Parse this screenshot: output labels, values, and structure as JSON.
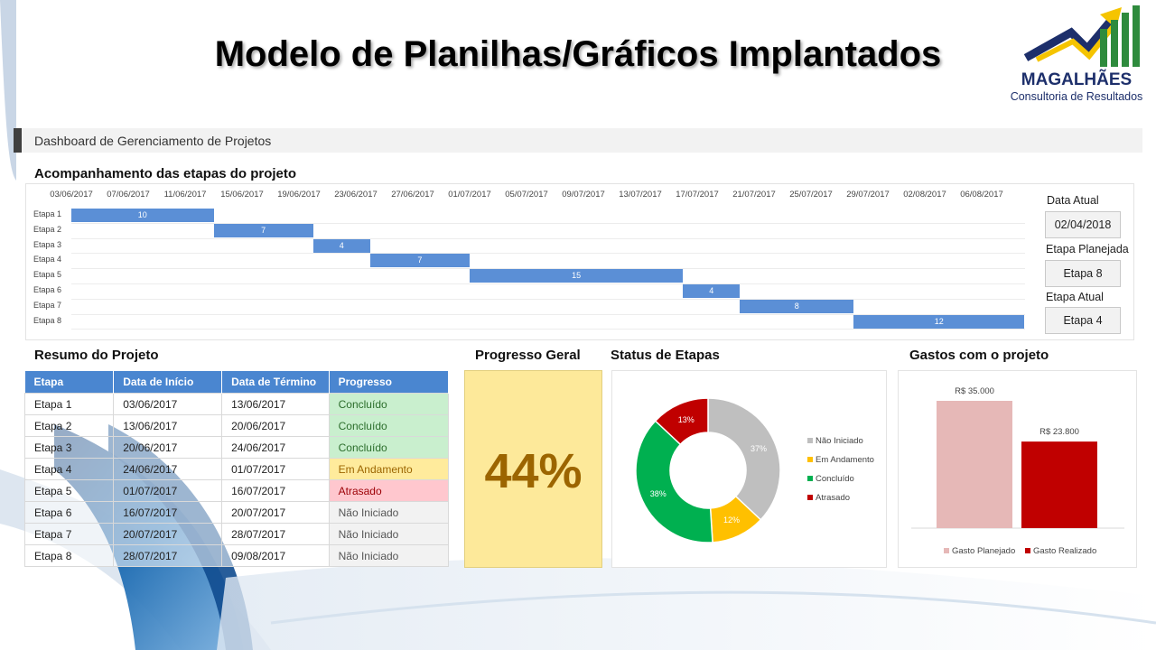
{
  "header": {
    "title": "Modelo de Planilhas/Gráficos Implantados"
  },
  "logo": {
    "name": "MAGALHÃES",
    "subtitle": "Consultoria de Resultados",
    "colors": [
      "#1d2f6b",
      "#f5c400",
      "#2e8b3d"
    ]
  },
  "dashboard": {
    "title": "Dashboard de Gerenciamento de Projetos"
  },
  "gantt": {
    "section_title": "Acompanhamento das etapas do projeto",
    "dates": [
      "03/06/2017",
      "07/06/2017",
      "11/06/2017",
      "15/06/2017",
      "19/06/2017",
      "23/06/2017",
      "27/06/2017",
      "01/07/2017",
      "05/07/2017",
      "09/07/2017",
      "13/07/2017",
      "17/07/2017",
      "21/07/2017",
      "25/07/2017",
      "29/07/2017",
      "02/08/2017",
      "06/08/2017"
    ],
    "etapas": [
      "Etapa 1",
      "Etapa 2",
      "Etapa 3",
      "Etapa 4",
      "Etapa 5",
      "Etapa 6",
      "Etapa 7",
      "Etapa 8"
    ],
    "durations": [
      10,
      7,
      4,
      7,
      15,
      4,
      8,
      12
    ],
    "start_offsets_days": [
      0,
      10,
      17,
      21,
      28,
      43,
      47,
      55
    ],
    "bar_color": "#5b8fd6"
  },
  "side_panel": {
    "data_atual_label": "Data Atual",
    "data_atual": "02/04/2018",
    "planejada_label": "Etapa Planejada",
    "planejada": "Etapa 8",
    "atual_label": "Etapa Atual",
    "atual": "Etapa 4"
  },
  "summary": {
    "section_title": "Resumo do Projeto",
    "columns": [
      "Etapa",
      "Data de Início",
      "Data de Término",
      "Progresso"
    ],
    "rows": [
      [
        "Etapa 1",
        "03/06/2017",
        "13/06/2017",
        "Concluído"
      ],
      [
        "Etapa 2",
        "13/06/2017",
        "20/06/2017",
        "Concluído"
      ],
      [
        "Etapa 3",
        "20/06/2017",
        "24/06/2017",
        "Concluído"
      ],
      [
        "Etapa 4",
        "24/06/2017",
        "01/07/2017",
        "Em Andamento"
      ],
      [
        "Etapa 5",
        "01/07/2017",
        "16/07/2017",
        "Atrasado"
      ],
      [
        "Etapa 6",
        "16/07/2017",
        "20/07/2017",
        "Não Iniciado"
      ],
      [
        "Etapa 7",
        "20/07/2017",
        "28/07/2017",
        "Não Iniciado"
      ],
      [
        "Etapa 8",
        "28/07/2017",
        "09/08/2017",
        "Não Iniciado"
      ]
    ]
  },
  "progress": {
    "section_title": "Progresso Geral",
    "value": "44%"
  },
  "status": {
    "section_title": "Status de Etapas",
    "legend": [
      "Não Iniciado",
      "Em Andamento",
      "Concluído",
      "Atrasado"
    ],
    "colors": [
      "#bfbfbf",
      "#ffc000",
      "#00b050",
      "#c00000"
    ],
    "labels": [
      "37%",
      "12%",
      "38%",
      "13%"
    ]
  },
  "gastos": {
    "section_title": "Gastos com o projeto",
    "legend": [
      "Gasto Planejado",
      "Gasto Realizado"
    ],
    "colors": [
      "#e6b8b7",
      "#c00000"
    ],
    "value_labels": [
      "R$ 35.000",
      "R$ 23.800"
    ]
  },
  "chart_data": [
    {
      "type": "bar",
      "title": "Acompanhamento das etapas do projeto",
      "categories": [
        "Etapa 1",
        "Etapa 2",
        "Etapa 3",
        "Etapa 4",
        "Etapa 5",
        "Etapa 6",
        "Etapa 7",
        "Etapa 8"
      ],
      "start_dates": [
        "03/06/2017",
        "13/06/2017",
        "20/06/2017",
        "24/06/2017",
        "01/07/2017",
        "16/07/2017",
        "20/07/2017",
        "28/07/2017"
      ],
      "values": [
        10,
        7,
        4,
        7,
        15,
        4,
        8,
        12
      ]
    },
    {
      "type": "pie",
      "title": "Status de Etapas",
      "categories": [
        "Não Iniciado",
        "Em Andamento",
        "Concluído",
        "Atrasado"
      ],
      "values": [
        37,
        12,
        38,
        13
      ]
    },
    {
      "type": "bar",
      "title": "Gastos com o projeto",
      "categories": [
        "Gasto Planejado",
        "Gasto Realizado"
      ],
      "values": [
        35000,
        23800
      ],
      "ylim": [
        0,
        35000
      ]
    }
  ]
}
